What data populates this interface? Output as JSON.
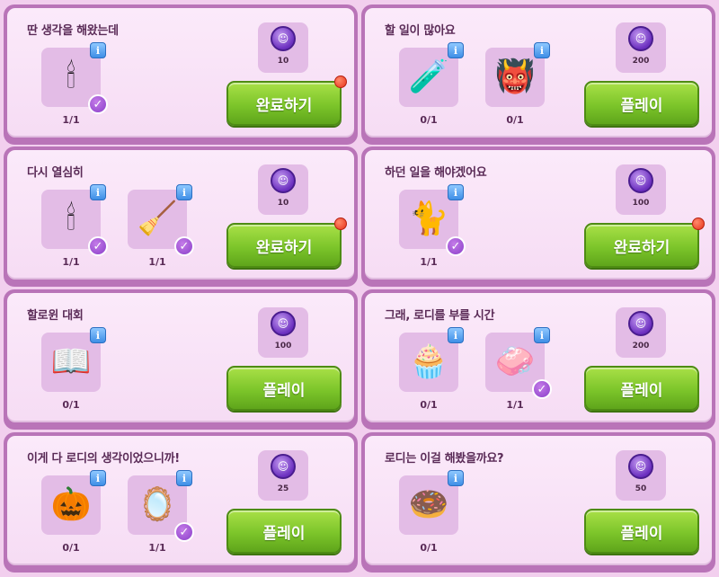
{
  "cards": [
    {
      "title": "딴 생각을 해왔는데",
      "reward": "10",
      "button": "완료하기",
      "button_alert": true,
      "items": [
        {
          "icon": "candelabra-icon",
          "glyph": "🕯",
          "count": "1/1",
          "done": true
        }
      ]
    },
    {
      "title": "할 일이 많아요",
      "reward": "200",
      "button": "플레이",
      "button_alert": false,
      "items": [
        {
          "icon": "potion-icon",
          "glyph": "🧪",
          "count": "0/1",
          "done": false
        },
        {
          "icon": "devil-mask-icon",
          "glyph": "👹",
          "count": "0/1",
          "done": false
        }
      ]
    },
    {
      "title": "다시 열심히",
      "reward": "10",
      "button": "완료하기",
      "button_alert": true,
      "items": [
        {
          "icon": "candle-holder-icon",
          "glyph": "🕯",
          "count": "1/1",
          "done": true
        },
        {
          "icon": "broom-icon",
          "glyph": "🧹",
          "count": "1/1",
          "done": true
        }
      ]
    },
    {
      "title": "하던 일을 해야겠어요",
      "reward": "100",
      "button": "완료하기",
      "button_alert": true,
      "items": [
        {
          "icon": "black-cat-icon",
          "glyph": "🐈",
          "count": "1/1",
          "done": true
        }
      ]
    },
    {
      "title": "할로윈 대회",
      "reward": "100",
      "button": "플레이",
      "button_alert": false,
      "items": [
        {
          "icon": "spell-book-icon",
          "glyph": "📖",
          "count": "0/1",
          "done": false
        }
      ]
    },
    {
      "title": "그래, 로디를 부를 시간",
      "reward": "200",
      "button": "플레이",
      "button_alert": false,
      "items": [
        {
          "icon": "witch-cupcake-icon",
          "glyph": "🧁",
          "count": "0/1",
          "done": false
        },
        {
          "icon": "soap-bar-icon",
          "glyph": "🧼",
          "count": "1/1",
          "done": true
        }
      ]
    },
    {
      "title": "이게 다 로디의 생각이었으니까!",
      "reward": "25",
      "button": "플레이",
      "button_alert": false,
      "items": [
        {
          "icon": "pumpkin-icon",
          "glyph": "🎃",
          "count": "0/1",
          "done": false
        },
        {
          "icon": "magic-mirror-icon",
          "glyph": "🪞",
          "count": "1/1",
          "done": true
        }
      ]
    },
    {
      "title": "로디는 이걸 해봤을까요?",
      "reward": "50",
      "button": "플레이",
      "button_alert": false,
      "items": [
        {
          "icon": "spiderweb-donut-icon",
          "glyph": "🍩",
          "count": "0/1",
          "done": false
        }
      ]
    }
  ],
  "colors": {
    "card_border": "#b974b8",
    "card_bg": "#fbeafa",
    "slot_bg": "#e3bce6",
    "button_green": "#7cc52a",
    "check_purple": "#8a3fc9",
    "info_blue": "#3f8ee6",
    "alert_red": "#e8321c"
  }
}
